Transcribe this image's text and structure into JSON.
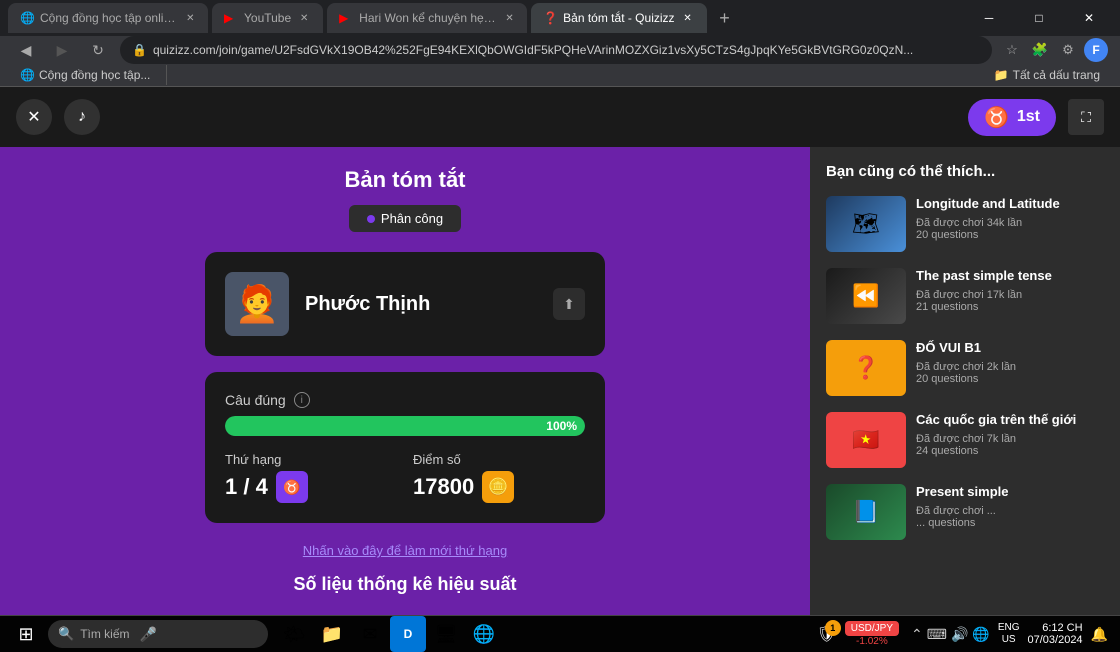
{
  "browser": {
    "tabs": [
      {
        "id": "tab1",
        "label": "Cộng đồng học tập online | Ho...",
        "active": false,
        "icon": "🌐"
      },
      {
        "id": "tab2",
        "label": "YouTube",
        "active": false,
        "icon": "▶"
      },
      {
        "id": "tab3",
        "label": "Hari Won kể chuyện hẹn hò vớ...",
        "active": false,
        "icon": "▶"
      },
      {
        "id": "tab4",
        "label": "Bản tóm tắt - Quizizz",
        "active": true,
        "icon": "❓"
      }
    ],
    "url": "quizizz.com/join/game/U2FsdGVkX19OB42%252FgE94KEXlQbOWGIdF5kPQHeVArinMOZXGiz1vsXy5CTzS4gJpqKYe5GkBVtGRG0z0QzN...",
    "bookmark": "Cộng đồng học tập...",
    "bookmark_folder": "Tất cả dấu trang"
  },
  "app": {
    "close_label": "✕",
    "music_label": "♪",
    "fullscreen_label": "⛶",
    "rank_badge": "1st",
    "rank_icon": "♉"
  },
  "summary": {
    "title": "Bản tóm tắt",
    "phan_cong_label": "Phân công",
    "player_name": "Phước Thịnh",
    "player_avatar": "🧑‍🦰",
    "accuracy_label": "Câu đúng",
    "accuracy_percent": "100%",
    "accuracy_value": 100,
    "rank_label": "Thứ hạng",
    "rank_value": "1 / 4",
    "score_label": "Điểm số",
    "score_value": "17800",
    "refresh_text": "Nhấn vào đây để làm mới thứ hạng",
    "perf_title": "Số liệu thống kê hiệu suất"
  },
  "suggestions": {
    "title": "Bạn cũng có thể thích...",
    "items": [
      {
        "title": "Longitude and Latitude",
        "played": "Đã được chơi 34k lần",
        "questions": "20 questions",
        "thumb_type": "geography",
        "thumb_emoji": "🗺"
      },
      {
        "title": "The past simple tense",
        "played": "Đã được chơi 17k lần",
        "questions": "21 questions",
        "thumb_type": "past",
        "thumb_emoji": "⏪"
      },
      {
        "title": "ĐỐ VUI B1",
        "played": "Đã được chơi 2k lần",
        "questions": "20 questions",
        "thumb_type": "dovu",
        "thumb_emoji": "❓"
      },
      {
        "title": "Các quốc gia trên thế giới",
        "played": "Đã được chơi 7k lần",
        "questions": "24 questions",
        "thumb_type": "country",
        "thumb_emoji": "🇻🇳"
      },
      {
        "title": "Present simple",
        "played": "Đã được chơi ...",
        "questions": "... questions",
        "thumb_type": "present",
        "thumb_emoji": "📘"
      }
    ]
  },
  "taskbar": {
    "search_placeholder": "Tìm kiếm",
    "stock_label": "USD/JPY",
    "stock_change": "-1.02%",
    "clock": "6:12 CH",
    "date": "07/03/2024",
    "lang": "ENG\nUS"
  }
}
